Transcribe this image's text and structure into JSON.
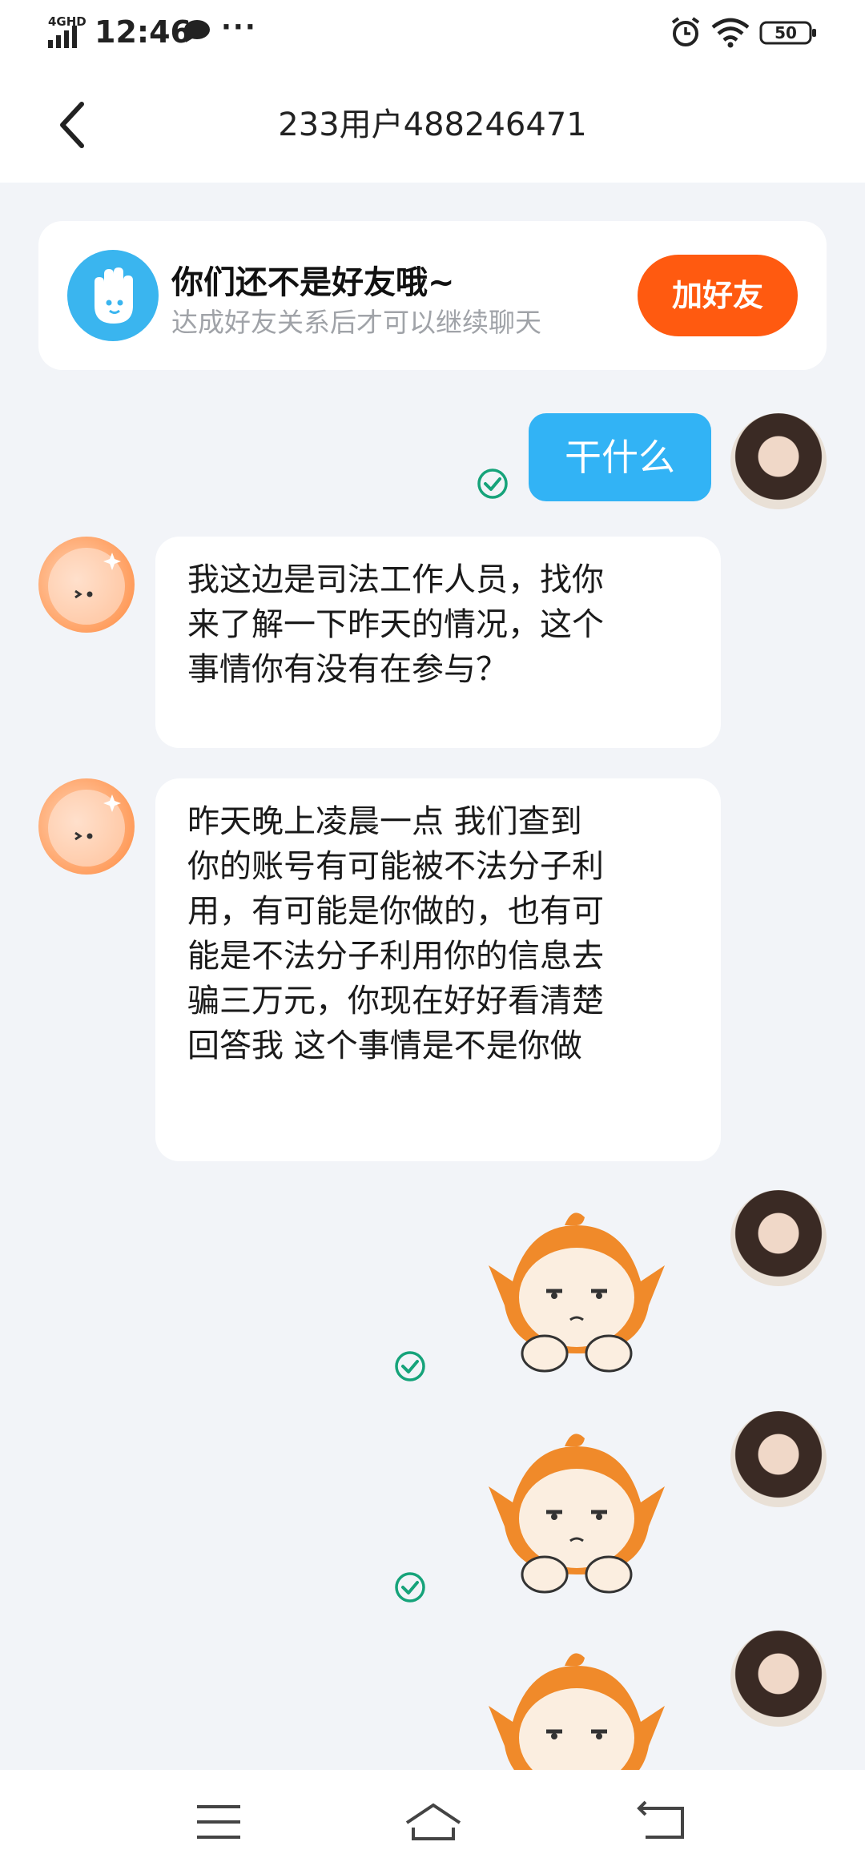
{
  "status_bar": {
    "network": "4GHD",
    "time": "12:46",
    "battery": "50"
  },
  "header": {
    "title": "233用户488246471"
  },
  "banner": {
    "title": "你们还不是好友哦~",
    "subtitle": "达成好友关系后才可以继续聊天",
    "button_label": "加好友"
  },
  "messages": [
    {
      "from": "me",
      "text": "干什么"
    },
    {
      "from": "other",
      "lines": [
        "我这边是司法工作人员，找你",
        "来了解一下昨天的情况，这个",
        "事情你有没有在参与？"
      ]
    },
    {
      "from": "other",
      "lines": [
        "昨天晚上凌晨一点 我们查到",
        "你的账号有可能被不法分子利",
        "用，有可能是你做的，也有可",
        "能是不法分子利用你的信息去",
        "骗三万元，你现在好好看清楚",
        "回答我 这个事情是不是你做"
      ]
    }
  ],
  "colors": {
    "accent_blue": "#32b3f5",
    "add_friend_orange": "#ff5a10",
    "sent_check_green": "#16a37a"
  },
  "icons": {
    "back": "chevron-left-icon",
    "menu": "menu-icon",
    "home": "home-icon",
    "return": "back-arrow-icon"
  }
}
